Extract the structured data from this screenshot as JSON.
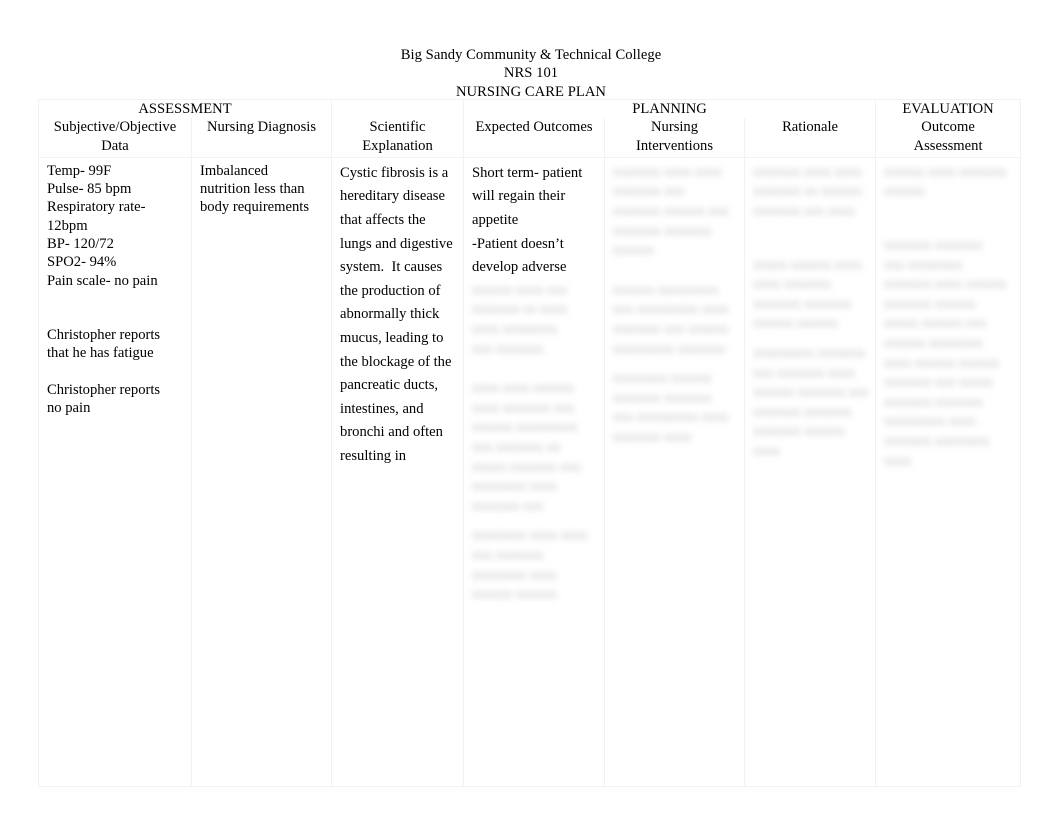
{
  "document": {
    "heading": {
      "line1": "Big Sandy Community & Technical College",
      "line2": "NRS 101",
      "line3": "NURSING CARE PLAN"
    }
  },
  "table": {
    "sections": {
      "assessment": "ASSESSMENT",
      "planning": "PLANNING",
      "evaluation": "EVALUATION"
    },
    "headers": [
      "Subjective/Objective\nData",
      "Nursing Diagnosis",
      "Scientific\nExplanation",
      "Expected Outcomes",
      "Nursing\nInterventions",
      "Rationale",
      "Outcome\nAssessment"
    ],
    "row": {
      "subjective_objective_data": {
        "vitals": "Temp- 99F\nPulse- 85 bpm\nRespiratory rate-\n12bpm\nBP- 120/72\nSPO2- 94%\nPain scale- no pain",
        "subjective_1": "Christopher reports\nthat he has fatigue",
        "subjective_2": "Christopher reports\nno pain"
      },
      "nursing_diagnosis": "Imbalanced\nnutrition less than\nbody requirements",
      "scientific_explanation": "Cystic fibrosis is a hereditary disease that affects the lungs and digestive system.  It causes the production of abnormally thick mucus, leading to the blockage of the pancreatic ducts, intestines, and bronchi and often resulting in respiratory",
      "expected_outcomes": {
        "visible": "Short term- patient\nwill regain their\nappetite\n-Patient doesn’t\ndevelop adverse",
        "redacted": [
          "xxxxxx xxxx xxx\nxxxxxxx xx xxxx\nxxxx xxxxxxxx\nxxx xxxxxxx",
          "xxxx xxxx xxxxxx\nxxxx xxxxxxx xxx\nxxxxxx xxxxxxxxx\nxxx xxxxxxx xx\nxxxxx xxxxxxx xxx\nxxxxxxxx xxxx\nxxxxxxx xxx",
          "xxxxxxxx xxxx xxxx\nxxx xxxxxxx\nxxxxxxxx xxxx\nxxxxxx xxxxxx"
        ]
      },
      "nursing_interventions": {
        "redacted": [
          "xxxxxxx xxxx xxxx\nxxxxxxx xxx\nxxxxxxx xxxxxx xxx\nxxxxxxx xxxxxxx\nxxxxxx",
          "xxxxxx xxxxxxxxx\nxxx xxxxxxxxx xxxx\nxxxxxxx xxx xxxxxx\nxxxxxxxxx xxxxxxx",
          "xxxxxxxx xxxxxx\nxxxxxxx xxxxxxx\nxxx xxxxxxxxx xxxx\nxxxxxxx xxxx"
        ]
      },
      "rationale": {
        "redacted": [
          "xxxxxxx xxxx xxxx\nxxxxxxx xx xxxxxx\nxxxxxxx xxx xxxx",
          "xxxxx xxxxxx xxxx\nxxxx xxxxxxx\nxxxxxxx xxxxxxx\nxxxxxx xxxxxx",
          "xxxxxxxxx xxxxxxx\nxxx xxxxxxx xxxx\nxxxxxx xxxxxxx xxx\nxxxxxxx xxxxxxx\nxxxxxxx xxxxxx\nxxxx"
        ]
      },
      "outcome_assessment": {
        "redacted": [
          "xxxxxx xxxx xxxxxxx\nxxxxxx",
          "xxxxxxx xxxxxxx\nxxx xxxxxxxx\nxxxxxxx xxxx xxxxxx\nxxxxxxx xxxxxx\nxxxxx xxxxxx xxx\nxxxxxx xxxxxxxx\nxxxx xxxxxx xxxxxx\nxxxxxxx xxx xxxxx\nxxxxxxx xxxxxxx\nxxxxxxxxx xxxx\nxxxxxxx xxxxxxxx\nxxxx"
        ]
      }
    }
  }
}
